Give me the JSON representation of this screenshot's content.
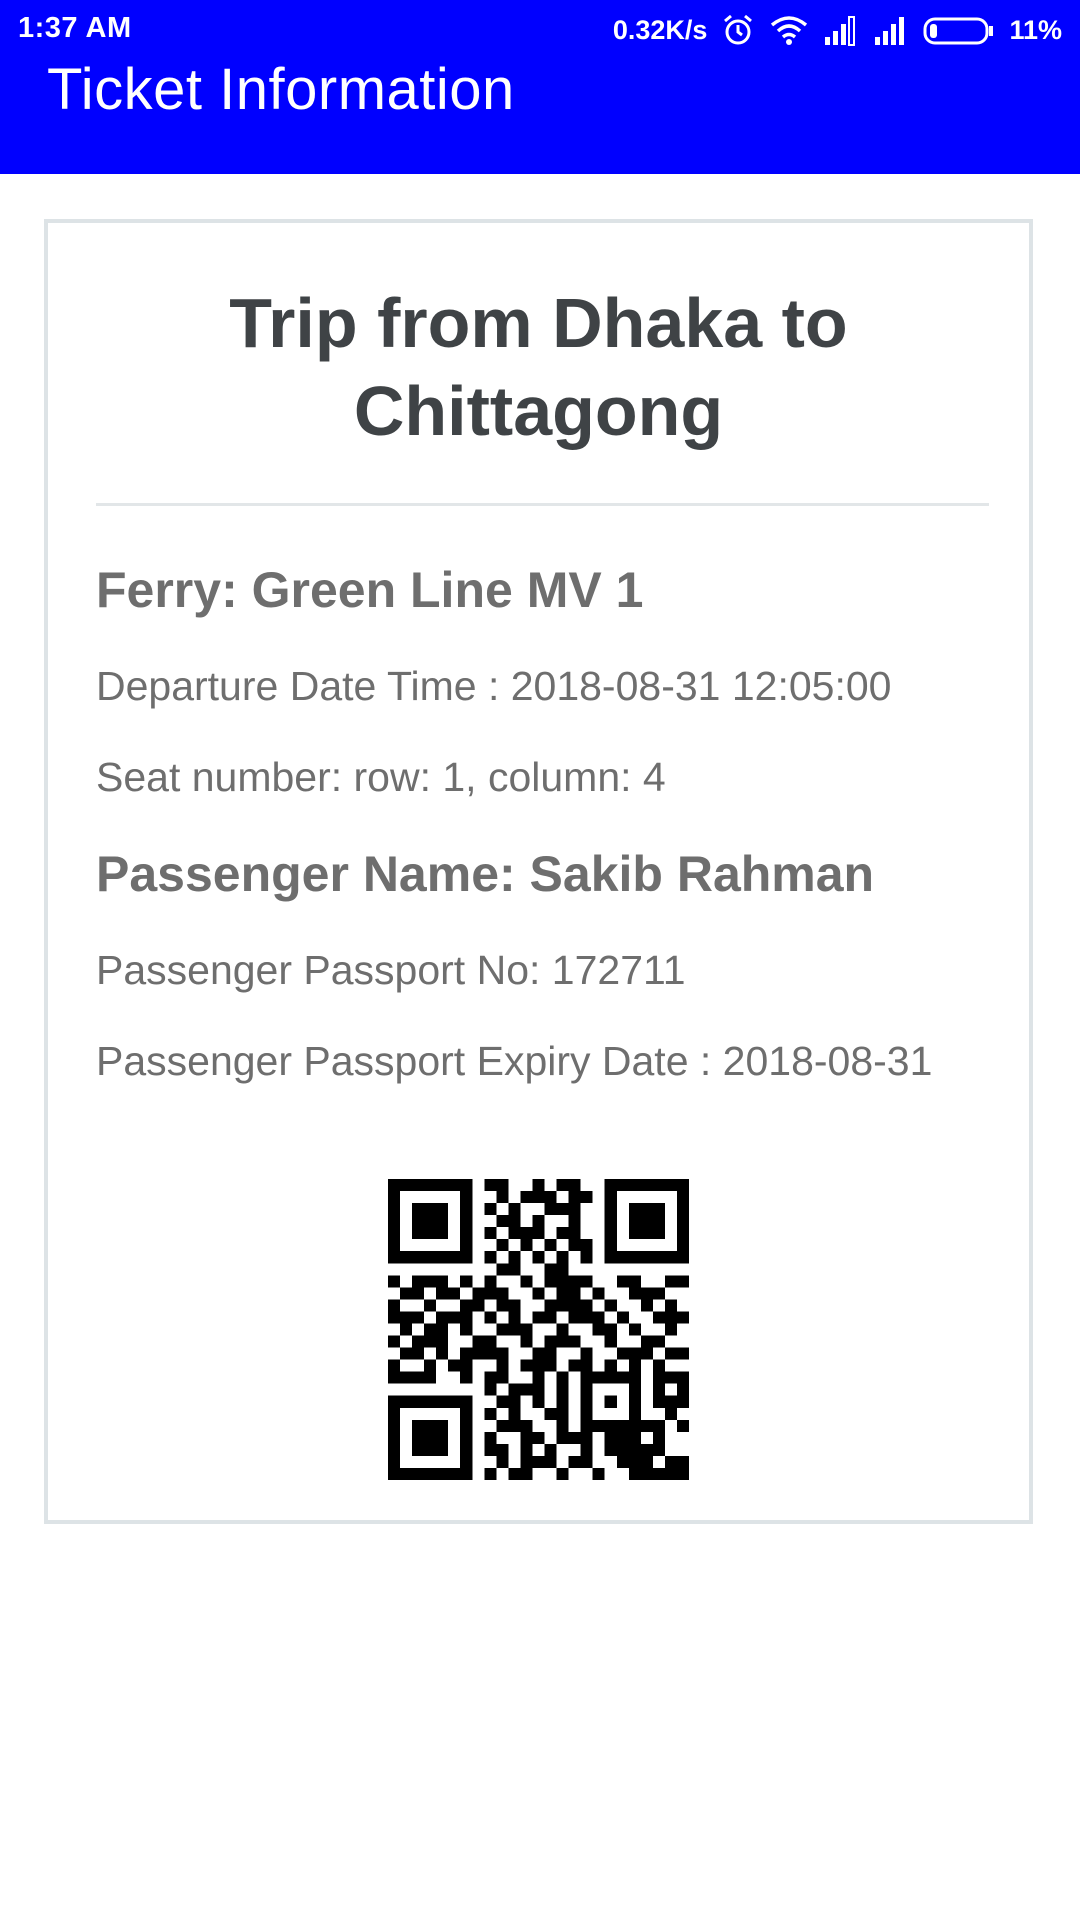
{
  "status_bar": {
    "time": "1:37 AM",
    "net_speed": "0.32K/s",
    "battery": "11%",
    "icons": [
      "alarm-icon",
      "wifi-icon",
      "signal-icon",
      "signal-icon",
      "battery-icon"
    ]
  },
  "app_bar": {
    "title": "Ticket Information",
    "color": "#0000ff"
  },
  "ticket": {
    "trip_title_line1": "Trip from Dhaka to",
    "trip_title_line2": "Chittagong",
    "ferry": "Ferry: Green Line MV 1",
    "departure": "Departure Date Time : 2018-08-31 12:05:00",
    "seat": "Seat number: row: 1, column: 4",
    "passenger_name": "Passenger Name: Sakib Rahman",
    "passport_no": "Passenger Passport No: 172711",
    "passport_expiry": "Passenger Passport Expiry Date : 2018-08-31"
  }
}
